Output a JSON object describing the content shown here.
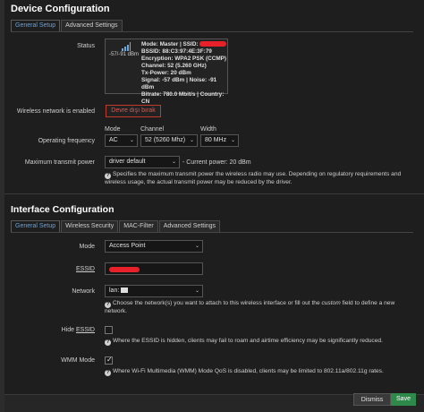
{
  "device": {
    "title": "Device Configuration",
    "tabs": [
      "General Setup",
      "Advanced Settings"
    ],
    "status_label": "Status",
    "signal_text": "-57/-91 dBm",
    "status": {
      "mode_line": "Mode: Master | SSID:",
      "bssid": "BSSID: 88:C3:97:4E:3F:79",
      "encryption": "Encryption: WPA2 PSK (CCMP)",
      "channel": "Channel: 52 (5.260 GHz)",
      "txpower": "Tx-Power: 20 dBm",
      "signal_line": "Signal: -57 dBm | Noise: -91 dBm",
      "bitrate_line": "Bitrate: 780.0 Mbit/s | Country: CN"
    },
    "wireless_enabled_label": "Wireless network is enabled",
    "disable_button": "Devre dışı bırak",
    "op_freq_label": "Operating frequency",
    "mode_header": "Mode",
    "channel_header": "Channel",
    "width_header": "Width",
    "mode_value": "AC",
    "channel_value": "52 (5260 Mhz)",
    "width_value": "80 MHz",
    "max_tx_label": "Maximum transmit power",
    "tx_value": "driver default",
    "tx_current": "- Current power: 20 dBm",
    "tx_help": "Specifies the maximum transmit power the wireless radio may use. Depending on regulatory requirements and wireless usage, the actual transmit power may be reduced by the driver."
  },
  "interface": {
    "title": "Interface Configuration",
    "tabs": [
      "General Setup",
      "Wireless Security",
      "MAC-Filter",
      "Advanced Settings"
    ],
    "mode_label": "Mode",
    "mode_value": "Access Point",
    "essid_label": "ESSID",
    "network_label": "Network",
    "network_value": "lan:",
    "network_help_1": "Choose the network(s) you want to attach to this wireless interface or fill out the",
    "network_help_custom": "custom",
    "network_help_2": "field to define a new network.",
    "hide_essid_label_1": "Hide",
    "hide_essid_label_2": "ESSID",
    "hide_help": "Where the ESSID is hidden, clients may fail to roam and airtime efficiency may be significantly reduced.",
    "wmm_label": "WMM Mode",
    "wmm_help": "Where Wi-Fi Multimedia (WMM) Mode QoS is disabled, clients may be limited to 802.11a/802.11g rates."
  },
  "footer": {
    "dismiss": "Dismiss",
    "save": "Save"
  },
  "colors": {
    "accent_tab": "#5aa6e8",
    "danger": "#c0392b",
    "save_green": "#2d8a4a",
    "redaction": "#e8202a"
  }
}
